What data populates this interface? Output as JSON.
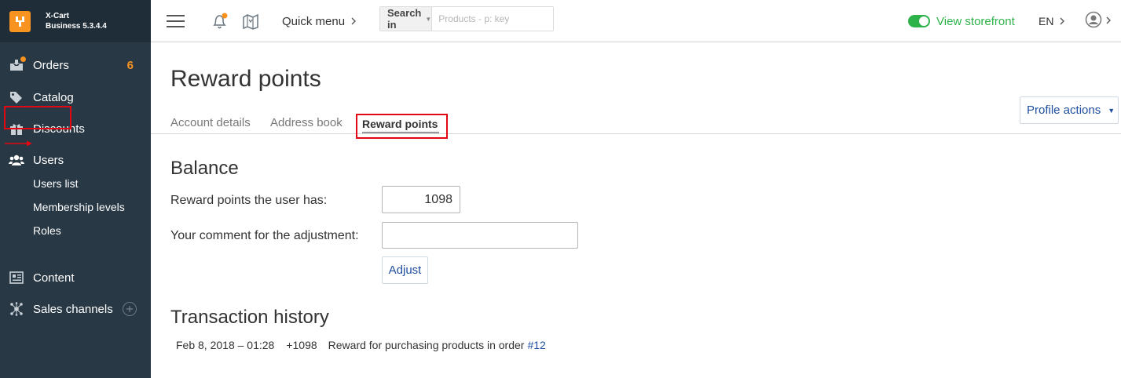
{
  "brand": {
    "name": "X-Cart",
    "edition": "Business 5.3.4.4"
  },
  "sidebar": {
    "items": [
      {
        "label": "Orders",
        "count": "6"
      },
      {
        "label": "Catalog"
      },
      {
        "label": "Discounts"
      },
      {
        "label": "Users"
      },
      {
        "label": "Content"
      },
      {
        "label": "Sales channels"
      }
    ],
    "users_subitems": [
      "Users list",
      "Membership levels",
      "Roles"
    ]
  },
  "header": {
    "quick_menu": "Quick menu",
    "search_button": "Search in",
    "search_placeholder": "Products - p: key",
    "view_storefront": "View storefront",
    "language": "EN"
  },
  "page": {
    "title": "Reward points",
    "tabs": [
      "Account details",
      "Address book",
      "Reward points"
    ],
    "active_tab": "Reward points",
    "profile_actions": "Profile actions"
  },
  "balance": {
    "heading": "Balance",
    "points_label": "Reward points the user has:",
    "points_value": "1098",
    "comment_label": "Your comment for the adjustment:",
    "comment_value": "",
    "adjust_button": "Adjust"
  },
  "history": {
    "heading": "Transaction history",
    "rows": [
      {
        "date": "Feb 8, 2018 – 01:28",
        "amount": "+1098",
        "description": "Reward for purchasing products in order",
        "order_link": "#12"
      }
    ]
  },
  "colors": {
    "sidebar_bg": "#283845",
    "accent_orange": "#f7931e",
    "storefront_green": "#2eb24a",
    "link_blue": "#1e4fa1",
    "highlight_red": "#e30613"
  }
}
